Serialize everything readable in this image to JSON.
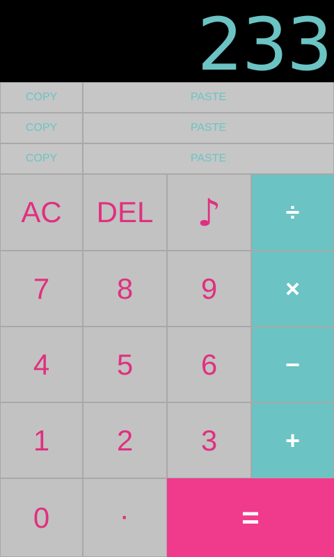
{
  "display": {
    "value": "233"
  },
  "clipboard_rows": [
    {
      "copy_label": "COPY",
      "paste_label": "PASTE"
    },
    {
      "copy_label": "COPY",
      "paste_label": "PASTE"
    },
    {
      "copy_label": "COPY",
      "paste_label": "PASTE"
    }
  ],
  "keypad": {
    "ac": "AC",
    "del": "DEL",
    "sound": "♪",
    "divide": "÷",
    "seven": "7",
    "eight": "8",
    "nine": "9",
    "multiply": "×",
    "four": "4",
    "five": "5",
    "six": "6",
    "minus": "−",
    "one": "1",
    "two": "2",
    "three": "3",
    "plus": "+",
    "zero": "0",
    "decimal": "·",
    "equals": "="
  },
  "colors": {
    "accent_teal": "#6cc3c3",
    "accent_pink": "#e0307f",
    "equals_pink": "#f03a8c",
    "key_gray": "#c2c2c2",
    "display_bg": "#000000"
  },
  "icons": {
    "sound": "music-note-icon"
  }
}
